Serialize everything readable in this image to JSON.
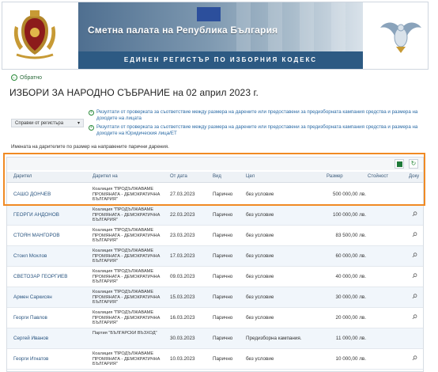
{
  "header": {
    "title": "Сметна палата на Република България",
    "subtitle": "ЕДИНЕН РЕГИСТЪР ПО ИЗБОРНИЯ КОДЕКС"
  },
  "nav": {
    "back_label": "Обратно"
  },
  "page_title": "ИЗБОРИ ЗА НАРОДНО СЪБРАНИЕ на 02 април 2023 г.",
  "reports": [
    "Резултати от проверката за съответствие между размера на дарените или предоставени за предизборната кампания средства и размера на доходите на лицата",
    "Резултати от проверката за съответствие между размера на дарените или предоставени за предизборната кампания средства и размера на доходите на Юридическия лица/ЕТ"
  ],
  "register_select": {
    "label": "Справки от регистъра",
    "caret": "▾"
  },
  "donors_note": "Имената на дарителите по размер на направените парични дарения.",
  "toolbar": {
    "export_icon": "excel-icon",
    "refresh_icon": "refresh-icon",
    "refresh_glyph": "↻"
  },
  "table": {
    "columns": [
      "Дарител",
      "Дарител на",
      "От дата",
      "Вид",
      "Цел",
      "Размер",
      "Стойност",
      "Доку"
    ],
    "rows": [
      {
        "donor": "САШО ДОНЧЕВ",
        "donor_to": "Коалиция \"ПРОДЪЛЖАВАМЕ ПРОМЯНАТА - ДЕМОКРАТИЧНА БЪЛГАРИЯ\"",
        "date": "27.03.2023",
        "type": "Парично",
        "purpose": "без условие",
        "amount": "500 000,00 лв.",
        "value": "",
        "has_doc": false
      },
      {
        "donor": "ГЕОРГИ АНДОНОВ",
        "donor_to": "Коалиция \"ПРОДЪЛЖАВАМЕ ПРОМЯНАТА - ДЕМОКРАТИЧНА БЪЛГАРИЯ\"",
        "date": "22.03.2023",
        "type": "Парично",
        "purpose": "без условие",
        "amount": "100 000,00 лв.",
        "value": "",
        "has_doc": true
      },
      {
        "donor": "СТОЯН МАНГОРОВ",
        "donor_to": "Коалиция \"ПРОДЪЛЖАВАМЕ ПРОМЯНАТА - ДЕМОКРАТИЧНА БЪЛГАРИЯ\"",
        "date": "23.03.2023",
        "type": "Парично",
        "purpose": "без условие",
        "amount": "83 500,00 лв.",
        "value": "",
        "has_doc": true
      },
      {
        "donor": "Стоил Мохлов",
        "donor_to": "Коалиция \"ПРОДЪЛЖАВАМЕ ПРОМЯНАТА - ДЕМОКРАТИЧНА БЪЛГАРИЯ\"",
        "date": "17.03.2023",
        "type": "Парично",
        "purpose": "без условие",
        "amount": "60 000,00 лв.",
        "value": "",
        "has_doc": true
      },
      {
        "donor": "СВЕТОЗАР ГЕОРГИЕВ",
        "donor_to": "Коалиция \"ПРОДЪЛЖАВАМЕ ПРОМЯНАТА - ДЕМОКРАТИЧНА БЪЛГАРИЯ\"",
        "date": "09.03.2023",
        "type": "Парично",
        "purpose": "без условие",
        "amount": "40 000,00 лв.",
        "value": "",
        "has_doc": true
      },
      {
        "donor": "Армен Саркисян",
        "donor_to": "Коалиция \"ПРОДЪЛЖАВАМЕ ПРОМЯНАТА - ДЕМОКРАТИЧНА БЪЛГАРИЯ\"",
        "date": "15.03.2023",
        "type": "Парично",
        "purpose": "без условие",
        "amount": "30 000,00 лв.",
        "value": "",
        "has_doc": true
      },
      {
        "donor": "Георги Павлов",
        "donor_to": "Коалиция \"ПРОДЪЛЖАВАМЕ ПРОМЯНАТА - ДЕМОКРАТИЧНА БЪЛГАРИЯ\"",
        "date": "16.03.2023",
        "type": "Парично",
        "purpose": "без условие",
        "amount": "20 000,00 лв.",
        "value": "",
        "has_doc": true
      },
      {
        "donor": "Сергей Иванов",
        "donor_to": "Партия \"БЪЛГАРСКИ ВЪЗХОД\"",
        "date": "30.03.2023",
        "type": "Парично",
        "purpose": "Предизборна кампания.",
        "amount": "11 000,00 лв.",
        "value": "",
        "has_doc": false
      },
      {
        "donor": "Георги Игнатов",
        "donor_to": "Коалиция \"ПРОДЪЛЖАВАМЕ ПРОМЯНАТА - ДЕМОКРАТИЧНА БЪЛГАРИЯ\"",
        "date": "10.03.2023",
        "type": "Парично",
        "purpose": "без условие",
        "amount": "10 000,00 лв.",
        "value": "",
        "has_doc": true
      }
    ]
  },
  "colors": {
    "highlight": "#f08a24",
    "accent_green": "#2a8a3a",
    "link_blue": "#2a6aa5",
    "banner_blue": "#2d5a83"
  }
}
